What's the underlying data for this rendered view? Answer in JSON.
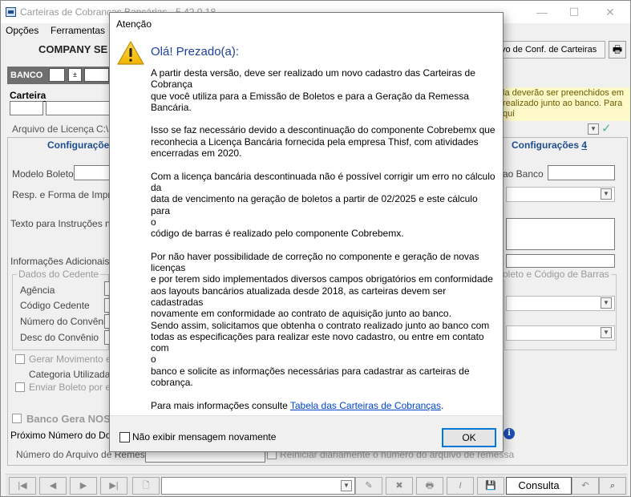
{
  "window": {
    "title": "Carteiras de Cobranças Bancárias - 5.42.0.18",
    "minimize": "—",
    "maximize": "☐",
    "close": "✕"
  },
  "menu": [
    "Opções",
    "Ferramentas"
  ],
  "company": "COMPANY SE",
  "toolbar": {
    "conf_button": "vo de Conf. de Carteiras"
  },
  "form": {
    "banco_label": "BANCO",
    "carteira_label": "Carteira",
    "arquivo_licenca": "Arquivo de Licença",
    "arquivo_licenca_value": "C:\\",
    "hint": "la deverão ser preenchidos em realizado junto ao banco. Para qui",
    "tab_left": "Configurações",
    "tab_right_label": "Configurações",
    "tab_right_num": "4",
    "modelo_boleto": "Modelo Boleto",
    "resp_forma": "Resp. e Forma de Impress",
    "texto_instrucoes": "Texto para Instruções no",
    "informacoes_adicionais": "Informações Adicionais ao",
    "dados_cedente": "Dados do Cedente",
    "agencia": "Agência",
    "codigo_cedente": "Código Cedente",
    "numero_convenio": "Número do Convênio",
    "desc_convenio": "Desc do Convênio",
    "ao_banco": "ao Banco",
    "boleto_codigo_barras": "oleto e Código de Barras",
    "gerar_movimento": "Gerar Movimento em",
    "categoria_utilizada": "Categoria Utilizada e",
    "enviar_boleto": "Enviar Boleto por em",
    "banco_gera_noss": "Banco Gera NOSS",
    "proximo_numero": "Próximo Número do Docu",
    "numero_arquivo_remessa": "Número do Arquivo de Remessa",
    "reiniciar_diariamente": "Reiniciar diariamente o número do arquivo de remessa"
  },
  "bottom": {
    "consulta": "Consulta"
  },
  "dialog": {
    "title": "Atenção",
    "heading": "Olá! Prezado(a):",
    "paragraphs": [
      [
        "A partir desta versão, deve ser realizado um novo cadastro das Carteiras de",
        "Cobrança",
        "que você utiliza para a Emissão de Boletos e para a Geração da Remessa Bancária."
      ],
      [
        "Isso se faz necessário devido a descontinuação do componente Cobrebemx que",
        "reconhecia a Licença Bancária fornecida pela empresa Thisf, com atividades",
        "encerradas em 2020."
      ],
      [
        "Com a licença bancária descontinuada não é possível corrigir um erro no cálculo",
        "da",
        "data de vencimento na geração de boletos a partir de 02/2025 e este cálculo para",
        "o",
        "código de barras é realizado pelo componente Cobrebemx."
      ],
      [
        "Por não haver possibilidade de correção no componente e geração de novas",
        "licenças",
        "e por terem sido implementados diversos campos obrigatórios em conformidade",
        "aos layouts bancários atualizada desde 2018, as carteiras devem ser cadastradas",
        "novamente em conformidade ao contrato de aquisição junto ao banco.",
        "Sendo assim, solicitamos que obtenha o contrato realizado junto ao banco com",
        "todas as especificações para realizar este novo cadastro, ou entre em contato com",
        "o",
        "banco e solicite as informações necessárias para cadastrar as carteiras de",
        "cobrança."
      ]
    ],
    "more_info_prefix": "Para mais informações consulte ",
    "more_info_link": "Tabela das Carteiras de Cobranças",
    "more_info_suffix": ".",
    "dont_show_label": "Não exibir mensagem novamente",
    "ok_label": "OK"
  }
}
